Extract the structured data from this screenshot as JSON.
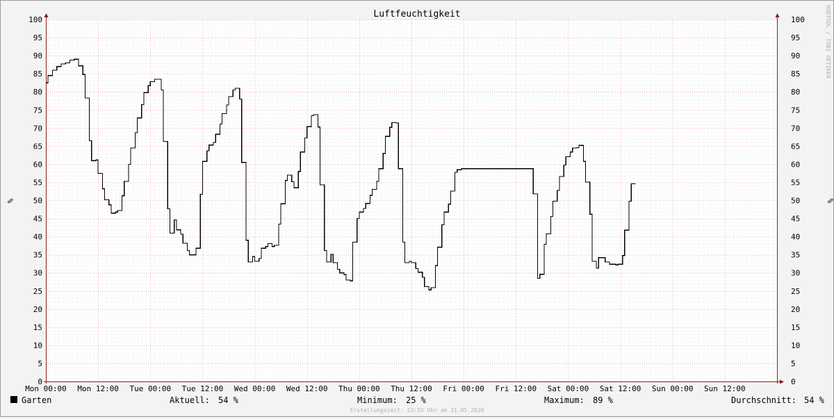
{
  "colors": {
    "background": "#f3f3f3",
    "plot_background": "#ffffff",
    "minor_grid": "#d8d8d8",
    "major_grid": "#e2a0a0",
    "line": "#000000",
    "axis": "#8b1a1a"
  },
  "legend": {
    "swatch_color": "#000000",
    "series_name": "Garten",
    "current_label": "Aktuell:",
    "current_value": "54 %",
    "min_label": "Minimum:",
    "min_value": "25 %",
    "max_label": "Maximum:",
    "max_value": "89 %",
    "avg_label": "Durchschnitt:",
    "avg_value": "54 %"
  },
  "watermark": "RRDTOOL / TOBI OETIKER",
  "created_text": "Erstellungszeit: 23:55 Uhr am 31.05.2020",
  "chart_data": {
    "type": "line",
    "title": "Luftfeuchtigkeit",
    "ylabel": "%",
    "ylim": [
      0,
      100
    ],
    "y_ticks": [
      0,
      5,
      10,
      15,
      20,
      25,
      30,
      35,
      40,
      45,
      50,
      55,
      60,
      65,
      70,
      75,
      80,
      85,
      90,
      95,
      100
    ],
    "xlim_hours": [
      0,
      168
    ],
    "x_ticks": [
      {
        "hour": 0,
        "label": "Mon 00:00"
      },
      {
        "hour": 12,
        "label": "Mon 12:00"
      },
      {
        "hour": 24,
        "label": "Tue 00:00"
      },
      {
        "hour": 36,
        "label": "Tue 12:00"
      },
      {
        "hour": 48,
        "label": "Wed 00:00"
      },
      {
        "hour": 60,
        "label": "Wed 12:00"
      },
      {
        "hour": 72,
        "label": "Thu 00:00"
      },
      {
        "hour": 84,
        "label": "Thu 12:00"
      },
      {
        "hour": 96,
        "label": "Fri 00:00"
      },
      {
        "hour": 108,
        "label": "Fri 12:00"
      },
      {
        "hour": 120,
        "label": "Sat 00:00"
      },
      {
        "hour": 132,
        "label": "Sat 12:00"
      },
      {
        "hour": 144,
        "label": "Sun 00:00"
      },
      {
        "hour": 156,
        "label": "Sun 12:00"
      }
    ],
    "grid": true,
    "series": [
      {
        "name": "Garten",
        "color": "#000000",
        "step": true,
        "x_hours": [
          0,
          0.5,
          1,
          1.5,
          2,
          2.5,
          3,
          3.5,
          4,
          4.5,
          5,
          5.5,
          6,
          6.5,
          7,
          7.5,
          8,
          8.5,
          9,
          9.5,
          10,
          10.5,
          11,
          11.5,
          12,
          12.5,
          13,
          13.5,
          14,
          14.5,
          15,
          15.5,
          16,
          16.5,
          17,
          17.5,
          18,
          18.5,
          19,
          19.5,
          20,
          20.5,
          21,
          21.5,
          22,
          22.5,
          23,
          23.5,
          24,
          24.5,
          25,
          25.5,
          26,
          26.5,
          27,
          27.5,
          28,
          28.5,
          29,
          29.5,
          30,
          30.5,
          31,
          31.5,
          32,
          32.5,
          33,
          33.5,
          34,
          34.5,
          35,
          35.5,
          36,
          36.5,
          37,
          37.5,
          38,
          38.5,
          39,
          39.5,
          40,
          40.5,
          41,
          41.5,
          42,
          42.5,
          43,
          43.5,
          44,
          44.5,
          45,
          45.5,
          46,
          46.5,
          47,
          47.5,
          48,
          48.5,
          49,
          49.5,
          50,
          50.5,
          51,
          51.5,
          52,
          52.5,
          53,
          53.5,
          54,
          54.5,
          55,
          55.5,
          56,
          56.5,
          57,
          57.5,
          58,
          58.5,
          59,
          59.5,
          60,
          60.5,
          61,
          61.5,
          62,
          62.5,
          63,
          63.5,
          64,
          64.5,
          65,
          65.5,
          66,
          66.5,
          67,
          67.5,
          68,
          68.5,
          69,
          69.5,
          70,
          70.5,
          71,
          71.5,
          72,
          72.5,
          73,
          73.5,
          74,
          74.5,
          75,
          75.5,
          76,
          76.5,
          77,
          77.5,
          78,
          78.5,
          79,
          79.5,
          80,
          80.5,
          81,
          81.5,
          82,
          82.5,
          83,
          83.5,
          84,
          84.5,
          85,
          85.5,
          86,
          86.5,
          87,
          87.5,
          88,
          88.5,
          89,
          89.5,
          90,
          90.5,
          91,
          91.5,
          92,
          92.5,
          93,
          93.5,
          94,
          94.5,
          95,
          95.5,
          96,
          96.5,
          97,
          97.5,
          98,
          98.5,
          99,
          99.5,
          100,
          100.5,
          101,
          101.5,
          102,
          102.5,
          103,
          103.5,
          104,
          104.5,
          105,
          105.5,
          106,
          106.5,
          107,
          107.5,
          108,
          108.5,
          109,
          109.5,
          110,
          110.5,
          111,
          111.5,
          112,
          112.5,
          113,
          113.5,
          114,
          114.5,
          115,
          115.5,
          116,
          116.5,
          117,
          117.5,
          118,
          118.5,
          119,
          119.5,
          120,
          120.5,
          121,
          121.5,
          122,
          122.5,
          123,
          123.5,
          124,
          124.5,
          125,
          125.5,
          126,
          126.5,
          127,
          127.5,
          128,
          128.5,
          129,
          129.5,
          130,
          130.5,
          131,
          131.5,
          132,
          132.5,
          133,
          133.5,
          134,
          134.5,
          135,
          135.5,
          136,
          136.5,
          137,
          137.5,
          138,
          138.5,
          139,
          139.5,
          140,
          140.5,
          141,
          141.5,
          142,
          142.5,
          143,
          143.5,
          144,
          144.5,
          145,
          145.5,
          146,
          146.5,
          147,
          147.5,
          148,
          148.5,
          149,
          149.5,
          150,
          150.5,
          151,
          151.5,
          152,
          152.5,
          153,
          153.5,
          154,
          154.5,
          155,
          155.5,
          156,
          156.5,
          157,
          157.5,
          158,
          158.5,
          159,
          159.5,
          160,
          160.5,
          161,
          161.5,
          162,
          162.5,
          163,
          163.5,
          164,
          164.5,
          165,
          165.5,
          166,
          166.5,
          167,
          167.5
        ],
        "values": [
          82.5,
          84.5,
          84.5,
          86,
          86,
          87,
          87,
          87.7,
          87.7,
          88,
          88,
          88.8,
          88.8,
          89,
          89,
          87.2,
          87.2,
          84.8,
          78.3,
          78.3,
          66.5,
          61,
          61,
          61.2,
          57.5,
          57.5,
          53.2,
          50.2,
          50.2,
          48.8,
          46.5,
          46.5,
          46.8,
          47.2,
          47.2,
          51.3,
          55.3,
          55.3,
          60,
          64.5,
          64.5,
          68.7,
          72.8,
          72.8,
          76.5,
          79.8,
          79.8,
          81.7,
          82.8,
          82.8,
          83.5,
          83.5,
          83.5,
          80.5,
          66.3,
          66.3,
          47.7,
          41,
          41,
          44.6,
          41.9,
          41.9,
          40.7,
          38.2,
          38.2,
          36.2,
          35,
          35,
          35,
          36.8,
          36.8,
          51.7,
          60.8,
          60.8,
          63.7,
          65.3,
          65.3,
          66,
          68.3,
          68.3,
          71.1,
          74,
          74,
          76.4,
          78.7,
          78.7,
          80.5,
          81,
          81,
          78,
          60.5,
          60.5,
          39,
          33,
          33,
          34.5,
          33.2,
          33.2,
          34,
          36.8,
          36.8,
          37.3,
          38.1,
          38.1,
          37.3,
          37.6,
          37.6,
          43.5,
          49.1,
          49.1,
          55.5,
          57,
          57,
          55.2,
          53.5,
          53.5,
          58,
          63.4,
          63.4,
          67.3,
          70.4,
          70.4,
          73.4,
          73.7,
          73.7,
          70.3,
          54.3,
          54.3,
          36.2,
          33,
          33,
          35.1,
          32.8,
          32.8,
          31,
          30,
          30,
          29.5,
          28,
          28,
          27.8,
          38.5,
          38.5,
          45,
          46.8,
          46.8,
          47.8,
          49.2,
          49.2,
          51.4,
          53.1,
          53.1,
          55.3,
          58.8,
          58.8,
          63,
          67.7,
          67.7,
          70.2,
          71.5,
          71.5,
          71.4,
          58.8,
          58.8,
          38.5,
          32.8,
          32.8,
          33.2,
          32.8,
          32.8,
          31.2,
          30.2,
          30.2,
          28.8,
          26.2,
          26.2,
          25.3,
          25.9,
          25.9,
          32,
          37.1,
          37.1,
          43.3,
          46.8,
          46.8,
          49,
          52.6,
          52.6,
          57.8,
          58.5,
          58.5,
          58.8,
          58.8,
          58.8,
          58.8,
          58.8,
          58.8,
          58.8,
          58.8,
          58.8,
          58.8,
          58.8,
          58.8,
          58.8,
          58.8,
          58.8,
          58.8,
          58.8,
          58.8,
          58.8,
          58.8,
          58.8,
          58.8,
          58.8,
          58.8,
          58.8,
          58.8,
          58.8,
          58.8,
          58.8,
          58.8,
          58.8,
          58.8,
          58.8,
          51.8,
          51.8,
          28.5,
          29.6,
          29.6,
          37.9,
          40.8,
          40.8,
          45.6,
          49.8,
          49.8,
          52.8,
          56.6,
          56.6,
          59.8,
          62.1,
          62.1,
          63.4,
          64.5,
          64.5,
          64.6,
          65.2,
          65.2,
          60.8,
          55.1,
          55.1,
          46.2,
          33.2,
          33.2,
          31.3,
          34.2,
          34.2,
          34.2,
          33,
          33,
          32.4,
          32.4,
          32.4,
          32.2,
          32.4,
          32.4,
          34.8,
          41.8,
          41.8,
          49.8,
          54.6,
          54.6
        ]
      }
    ]
  }
}
